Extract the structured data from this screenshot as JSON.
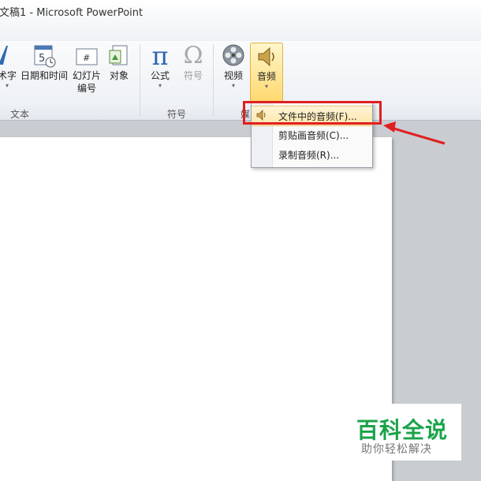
{
  "window": {
    "title": "文稿1  -  Microsoft PowerPoint"
  },
  "ribbon": {
    "buttons": {
      "wordart": {
        "label": "术字",
        "icon": "wordart-icon"
      },
      "datetime": {
        "label": "日期和时间",
        "icon": "calendar-clock-icon"
      },
      "slide_number": {
        "label_line1": "幻灯片",
        "label_line2": "编号",
        "icon": "slide-number-icon"
      },
      "object": {
        "label": "对象",
        "icon": "object-icon"
      },
      "equation": {
        "label": "公式",
        "icon": "pi-icon",
        "glyph": "π"
      },
      "symbol": {
        "label": "符号",
        "icon": "omega-icon",
        "glyph": "Ω"
      },
      "video": {
        "label": "视频",
        "icon": "film-reel-icon"
      },
      "audio": {
        "label": "音频",
        "icon": "speaker-icon"
      }
    },
    "groups": {
      "text": "文本",
      "symbols": "符号",
      "media_partial": "媒"
    }
  },
  "audio_menu": {
    "items": [
      {
        "label": "文件中的音频(F)...",
        "highlighted": true,
        "icon": "speaker-icon"
      },
      {
        "label": "剪贴画音频(C)..."
      },
      {
        "label": "录制音频(R)..."
      }
    ]
  },
  "annotation": {
    "highlight_color": "#e02020"
  },
  "watermark": {
    "title": "百科全说",
    "subtitle": "助你轻松解决",
    "color": "#1aa34a"
  }
}
